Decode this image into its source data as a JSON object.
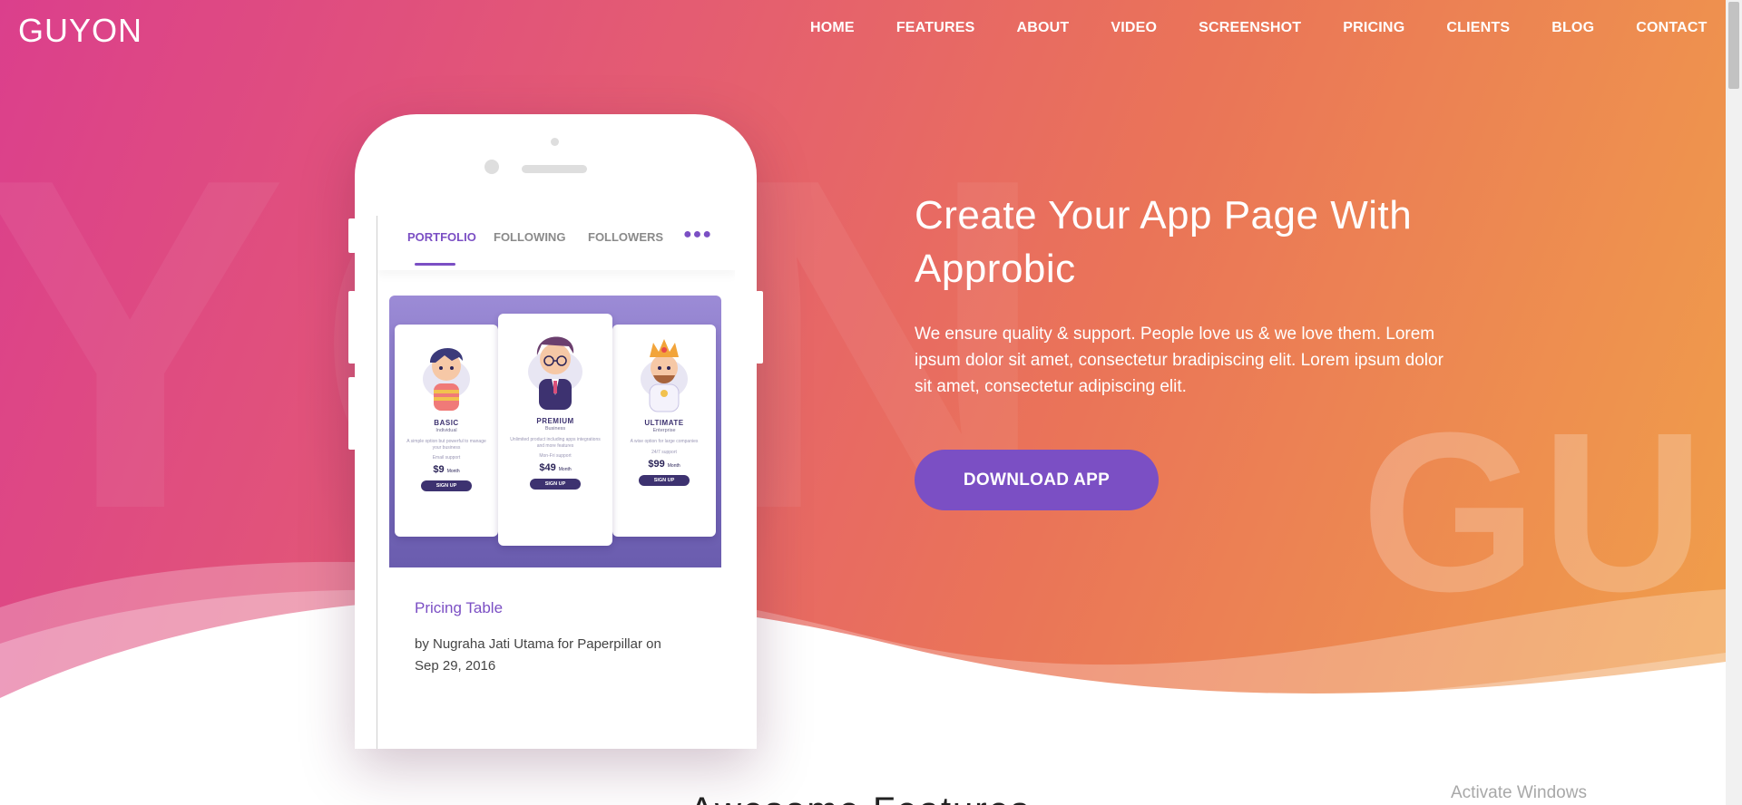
{
  "brand": {
    "logo": "GUYON"
  },
  "nav": {
    "items": [
      "HOME",
      "FEATURES",
      "ABOUT",
      "VIDEO",
      "SCREENSHOT",
      "PRICING",
      "CLIENTS",
      "BLOG",
      "CONTACT"
    ]
  },
  "background_letters": {
    "left": "YON",
    "right": "GU"
  },
  "phone": {
    "tabs": [
      "PORTFOLIO",
      "FOLLOWING",
      "FOLLOWERS"
    ],
    "more_icon": "more-dots-icon",
    "pricing_preview": {
      "plans": [
        {
          "name": "BASIC",
          "sub": "Individual",
          "desc": "A simple option but powerful to manage your business",
          "support": "Email support",
          "price": "$9",
          "period": "Month",
          "button": "SIGN UP"
        },
        {
          "name": "PREMIUM",
          "sub": "Business",
          "desc": "Unlimited product including apps integrations and more features",
          "support": "Mon-Fri support",
          "price": "$49",
          "period": "Month",
          "button": "SIGN UP"
        },
        {
          "name": "ULTIMATE",
          "sub": "Enterprise",
          "desc": "A wise option for large companies",
          "support": "24/7 support",
          "price": "$99",
          "period": "Month",
          "button": "SIGN UP"
        }
      ]
    },
    "card_title": "Pricing Table",
    "card_byline": "by Nugraha Jati Utama for Paperpillar on Sep 29, 2016"
  },
  "hero": {
    "headline": "Create Your App Page With Approbic",
    "subtext": "We ensure quality & support. People love us & we love them. Lorem ipsum dolor sit amet, consectetur bradipiscing elit. Lorem ipsum dolor sit amet, consectetur adipiscing elit.",
    "cta": "DOWNLOAD APP"
  },
  "next_section": {
    "partial_heading": "Awesome Features"
  },
  "os_watermark": "Activate Windows",
  "colors": {
    "gradient_start": "#db3f8c",
    "gradient_end": "#f09f4a",
    "accent_purple": "#7b4fc4"
  }
}
